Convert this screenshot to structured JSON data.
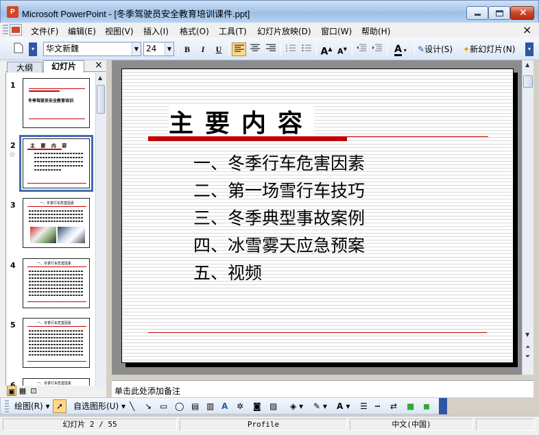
{
  "window": {
    "title": "Microsoft PowerPoint - [冬季驾驶员安全教育培训课件.ppt]",
    "app_icon_letter": "P"
  },
  "menubar": {
    "items": [
      "文件(F)",
      "编辑(E)",
      "视图(V)",
      "插入(I)",
      "格式(O)",
      "工具(T)",
      "幻灯片放映(D)",
      "窗口(W)",
      "帮助(H)"
    ]
  },
  "toolbar": {
    "font_name": "华文新魏",
    "font_size": "24",
    "bold": "B",
    "italic": "I",
    "underline": "U",
    "design_label": "设计(S)",
    "new_slide_label": "新幻灯片(N)",
    "font_color_letter": "A"
  },
  "left_pane": {
    "tabs": [
      "大纲",
      "幻灯片"
    ],
    "close": "×",
    "thumbnails": [
      {
        "num": "1",
        "text": "冬季驾驶员安全教育培训"
      },
      {
        "num": "2",
        "text": "主 要 内 容"
      },
      {
        "num": "3",
        "text": "一、冬季行车危害因素"
      },
      {
        "num": "4",
        "text": "一、冬季行车危害因素"
      },
      {
        "num": "5",
        "text": "一、冬季行车危害因素"
      },
      {
        "num": "6",
        "text": "一、冬季行车危害因素"
      }
    ],
    "selected_slide": 2
  },
  "slide": {
    "heading": "主要内容",
    "items": [
      "一、冬季行车危害因素",
      "二、第一场雪行车技巧",
      "三、冬季典型事故案例",
      "四、冰雪雾天应急预案",
      "五、视频"
    ]
  },
  "notes": {
    "placeholder": "单击此处添加备注"
  },
  "drawbar": {
    "draw_label": "绘图(R)",
    "autoshapes_label": "自选图形(U)"
  },
  "statusbar": {
    "slide_info": "幻灯片 2 / 55",
    "design": "Profile",
    "language": "中文(中国)"
  },
  "colors": {
    "accent_red": "#c00000",
    "selection_blue": "#3e6bb4"
  }
}
